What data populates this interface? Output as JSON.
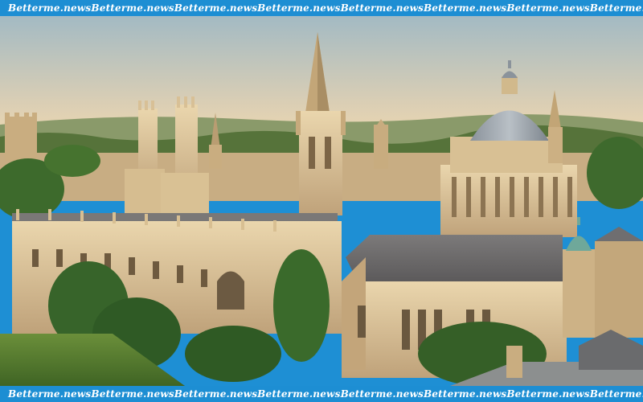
{
  "watermark": {
    "text": "Betterme.news",
    "count_per_bar": 9
  },
  "photo": {
    "sky_top": "#9fb7c2",
    "sky_bottom": "#f0dcb6",
    "stone_light": "#e3cda2",
    "stone_mid": "#c9ab7a",
    "stone_dark": "#8e7650",
    "roof_slate": "#6f6e70",
    "dome": "#a9b0b7",
    "tree_green": "#3b6a2b",
    "lawn_green": "#557a31",
    "copper_green": "#6fa89a"
  },
  "colors": {
    "bar_blue": "#1d8ed3",
    "bar_text": "#ffffff"
  }
}
